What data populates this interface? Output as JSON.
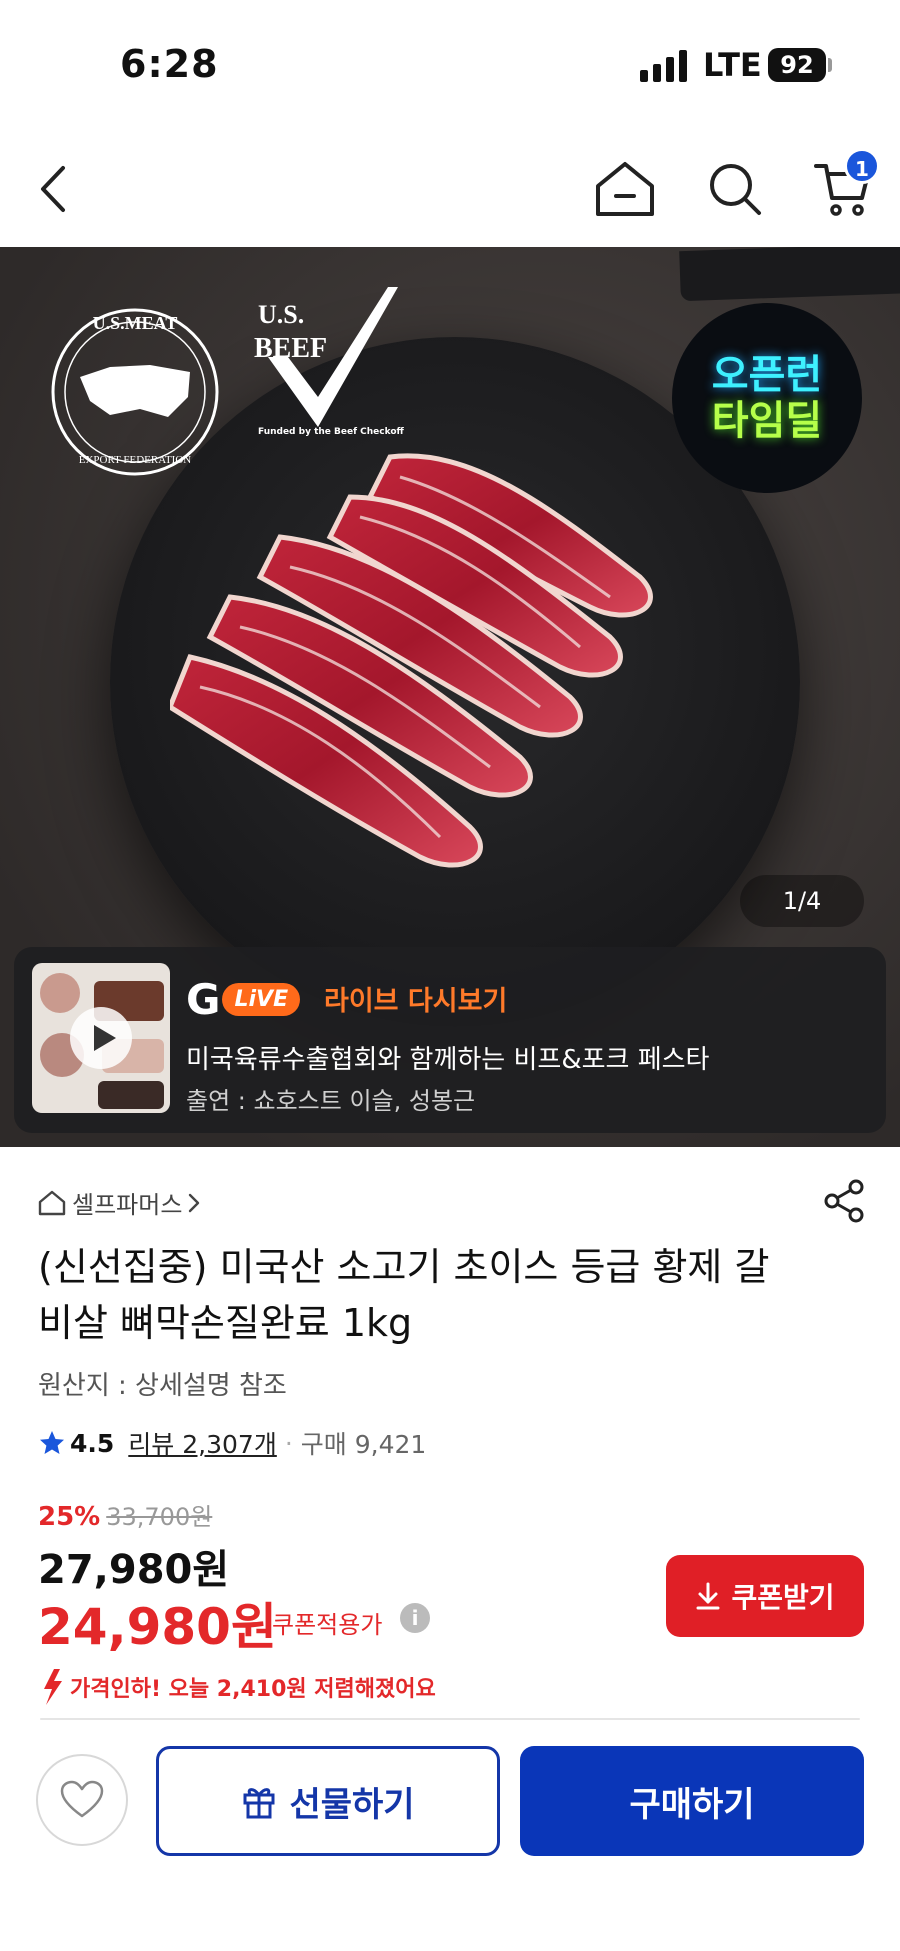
{
  "status_bar": {
    "time": "6:28",
    "network": "LTE",
    "battery": "92"
  },
  "nav": {
    "cart_count": "1"
  },
  "hero": {
    "logos": {
      "usmef_top": "U.S.MEAT",
      "usmef_bottom": "EXPORT FEDERATION",
      "usbeef": "U.S. BEEF",
      "usbeef_fund": "Funded by the Beef Checkoff"
    },
    "timedeal": {
      "line1": "오픈런",
      "line2": "타임딜"
    },
    "image_counter": "1/4",
    "live": {
      "g": "G",
      "pill": "LiVE",
      "title": "라이브 다시보기",
      "subtitle": "미국육류수출협회와 함께하는 비프&포크 페스타",
      "cast": "출연 : 쇼호스트 이슬, 성봉근"
    }
  },
  "product": {
    "seller": "셀프파머스",
    "title": "(신선집중) 미국산 소고기 초이스 등급 황제 갈비살 뼈막손질완료 1kg",
    "origin": "원산지 : 상세설명 참조",
    "rating": "4.5",
    "review_label": "리뷰 2,307개",
    "purchase_label": "구매 9,421",
    "discount_rate": "25%",
    "original_price": "33,700원",
    "sale_price": "27,980원",
    "coupon_price": "24,980원",
    "coupon_label": "쿠폰적용가",
    "coupon_button": "쿠폰받기",
    "price_drop": "가격인하! 오늘 2,410원 저렴해졌어요"
  },
  "bottom_bar": {
    "gift_label": "선물하기",
    "buy_label": "구매하기"
  },
  "colors": {
    "accent_red": "#e01f26",
    "primary_blue": "#0a36b8",
    "badge_blue": "#1a56db"
  }
}
